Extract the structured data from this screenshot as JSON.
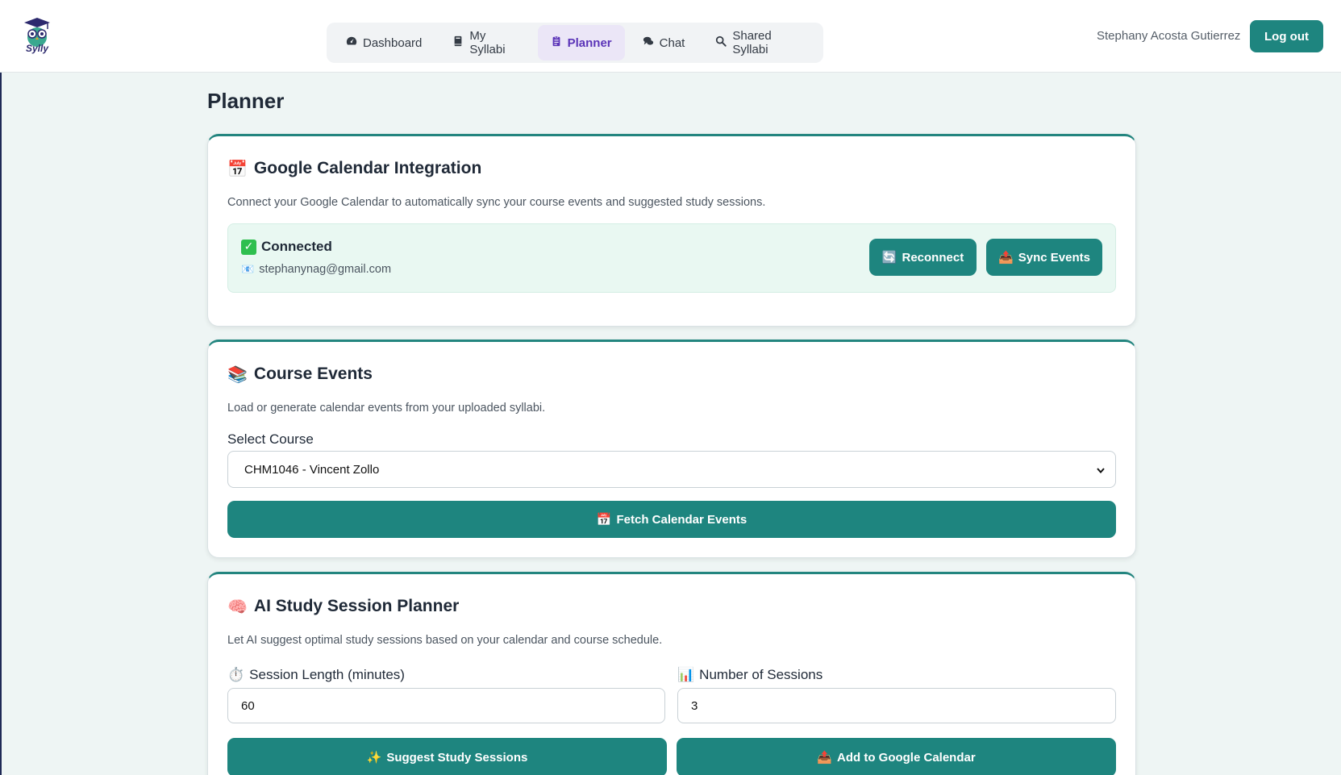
{
  "app": {
    "logo_text": "Sylly"
  },
  "nav": {
    "items": [
      {
        "label": "Dashboard",
        "icon": "gauge-icon"
      },
      {
        "label": "My Syllabi",
        "icon": "book-icon"
      },
      {
        "label": "Planner",
        "icon": "clipboard-icon",
        "active": true
      },
      {
        "label": "Chat",
        "icon": "comments-icon"
      },
      {
        "label": "Shared Syllabi",
        "icon": "search-icon"
      }
    ]
  },
  "user": {
    "name": "Stephany Acosta Gutierrez",
    "logout_label": "Log out"
  },
  "page": {
    "title": "Planner"
  },
  "calendar_integration": {
    "emoji": "📅",
    "title": "Google Calendar Integration",
    "description": "Connect your Google Calendar to automatically sync your course events and suggested study sessions.",
    "status": "Connected",
    "email_emoji": "📧",
    "email": "stephanynag@gmail.com",
    "reconnect_emoji": "🔄",
    "reconnect_label": "Reconnect",
    "sync_emoji": "📤",
    "sync_label": "Sync Events"
  },
  "course_events": {
    "emoji": "📚",
    "title": "Course Events",
    "description": "Load or generate calendar events from your uploaded syllabi.",
    "select_label": "Select Course",
    "selected_course": "CHM1046 - Vincent Zollo",
    "fetch_emoji": "📅",
    "fetch_label": "Fetch Calendar Events"
  },
  "study_planner": {
    "emoji": "🧠",
    "title": "AI Study Session Planner",
    "description": "Let AI suggest optimal study sessions based on your calendar and course schedule.",
    "session_length_emoji": "⏱️",
    "session_length_label": "Session Length (minutes)",
    "session_length_value": "60",
    "num_sessions_emoji": "📊",
    "num_sessions_label": "Number of Sessions",
    "num_sessions_value": "3",
    "suggest_emoji": "✨",
    "suggest_label": "Suggest Study Sessions",
    "add_emoji": "📤",
    "add_label": "Add to Google Calendar"
  },
  "colors": {
    "accent": "#1e857f",
    "nav_active_bg": "#ebe6f7",
    "nav_active_text": "#5b34b8",
    "connected_bg": "#e9f8f2",
    "page_bg": "#eef5f4"
  }
}
